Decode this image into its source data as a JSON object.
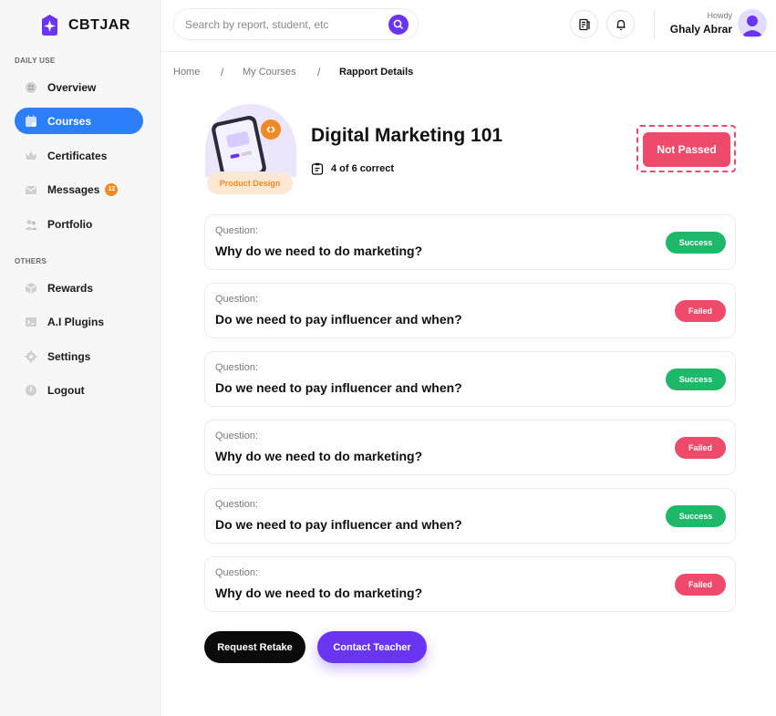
{
  "app": {
    "logo_text": "CBTJAR"
  },
  "sidebar": {
    "section_daily": "DAILY USE",
    "section_others": "OTHERS",
    "daily_items": [
      {
        "label": "Overview",
        "icon": "grid-icon",
        "active": false
      },
      {
        "label": "Courses",
        "icon": "calendar-icon",
        "active": true
      },
      {
        "label": "Certificates",
        "icon": "crown-icon",
        "active": false
      },
      {
        "label": "Messages",
        "icon": "mail-icon",
        "active": false,
        "badge": "12"
      },
      {
        "label": "Portfolio",
        "icon": "people-icon",
        "active": false
      }
    ],
    "other_items": [
      {
        "label": "Rewards",
        "icon": "box-icon"
      },
      {
        "label": "A.I Plugins",
        "icon": "terminal-icon"
      },
      {
        "label": "Settings",
        "icon": "gear-icon"
      },
      {
        "label": "Logout",
        "icon": "logout-icon"
      }
    ]
  },
  "header": {
    "search_placeholder": "Search by report, student, etc",
    "greeting": "Howdy",
    "user_name": "Ghaly Abrar"
  },
  "breadcrumb": {
    "items": [
      "Home",
      "My Courses",
      "Rapport Details"
    ],
    "separator": "/"
  },
  "course": {
    "title": "Digital Marketing 101",
    "tag": "Product Design",
    "score": "4 of 6 correct",
    "status": "Not Passed"
  },
  "questions": [
    {
      "label": "Question:",
      "text": "Why do we need to do marketing?",
      "status": "Success"
    },
    {
      "label": "Question:",
      "text": "Do we need to pay influencer and when?",
      "status": "Failed"
    },
    {
      "label": "Question:",
      "text": "Do we need to pay influencer and when?",
      "status": "Success"
    },
    {
      "label": "Question:",
      "text": "Why do we need to do marketing?",
      "status": "Failed"
    },
    {
      "label": "Question:",
      "text": "Do we need to pay influencer and when?",
      "status": "Success"
    },
    {
      "label": "Question:",
      "text": "Why do we need to do marketing?",
      "status": "Failed"
    }
  ],
  "actions": {
    "retake": "Request Retake",
    "contact": "Contact Teacher"
  },
  "colors": {
    "primary_purple": "#6a35f2",
    "active_blue": "#2d7ff9",
    "success_green": "#1fb86a",
    "failed_red": "#ef4a6b",
    "badge_orange": "#f08a24"
  }
}
